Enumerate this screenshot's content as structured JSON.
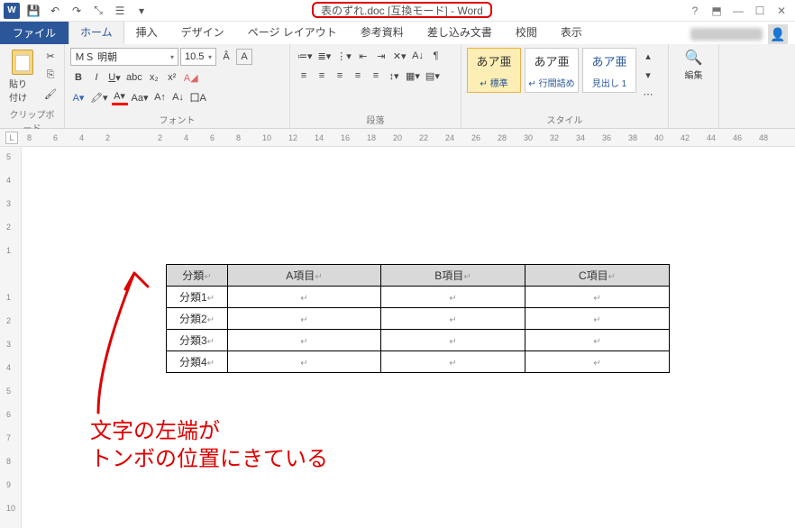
{
  "title": "表のずれ.doc [互換モード] - Word",
  "tabs": {
    "file": "ファイル",
    "home": "ホーム",
    "insert": "挿入",
    "design": "デザイン",
    "layout": "ページ レイアウト",
    "references": "参考資料",
    "mailings": "差し込み文書",
    "review": "校閲",
    "view": "表示"
  },
  "groups": {
    "clipboard": "クリップボード",
    "font": "フォント",
    "paragraph": "段落",
    "styles": "スタイル",
    "editing": "編集"
  },
  "clipboard": {
    "paste": "貼り付け"
  },
  "font": {
    "name": "ＭＳ 明朝",
    "size": "10.5"
  },
  "styles": {
    "s1": {
      "sample": "あア亜",
      "label": "↵ 標準"
    },
    "s2": {
      "sample": "あア亜",
      "label": "↵ 行間詰め"
    },
    "s3": {
      "sample": "あア亜",
      "label": "見出し 1"
    }
  },
  "table": {
    "headers": [
      "分類",
      "A項目",
      "B項目",
      "C項目"
    ],
    "rows": [
      "分類1",
      "分類2",
      "分類3",
      "分類4"
    ]
  },
  "annotation": {
    "line1": "文字の左端が",
    "line2": "トンボの位置にきている"
  },
  "ruler_h": [
    "8",
    "6",
    "4",
    "2",
    "",
    "2",
    "4",
    "6",
    "8",
    "10",
    "12",
    "14",
    "16",
    "18",
    "20",
    "22",
    "24",
    "26",
    "28",
    "30",
    "32",
    "34",
    "36",
    "38",
    "40",
    "42",
    "44",
    "46",
    "48"
  ],
  "ruler_v": [
    "5",
    "4",
    "3",
    "2",
    "1",
    "",
    "1",
    "2",
    "3",
    "4",
    "5",
    "6",
    "7",
    "8",
    "9",
    "10"
  ]
}
